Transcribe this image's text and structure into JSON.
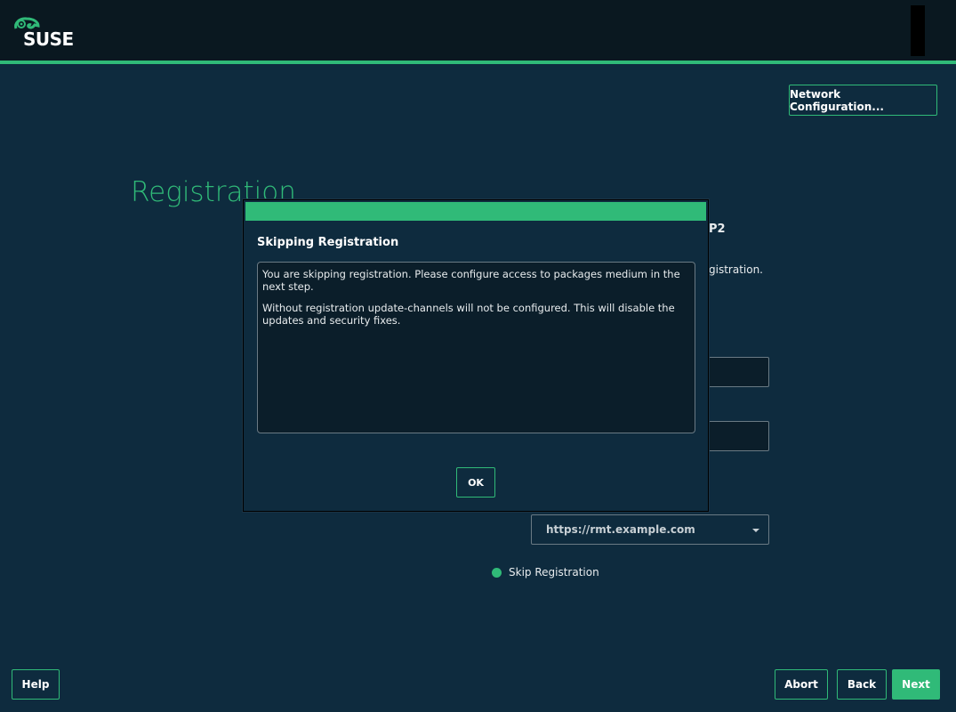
{
  "brand": {
    "logo_text": "SUSE",
    "accent": "#30ba78",
    "background": "#0e2b3e"
  },
  "header": {
    "network_button_label": "Network Configuration..."
  },
  "page": {
    "title": "Registration",
    "product_fragment": "P2",
    "registration_fragment": "gistration.",
    "server_combo_value": "https://rmt.example.com",
    "skip_label": "Skip Registration"
  },
  "dialog": {
    "title": "Skipping Registration",
    "paragraph1": "You are skipping registration. Please configure access to packages medium in the next step.",
    "paragraph2": "Without registration update-channels will not be configured. This will disable the updates and security fixes.",
    "ok_label": "OK"
  },
  "footer": {
    "help_label": "Help",
    "abort_label": "Abort",
    "back_label": "Back",
    "next_label": "Next"
  }
}
